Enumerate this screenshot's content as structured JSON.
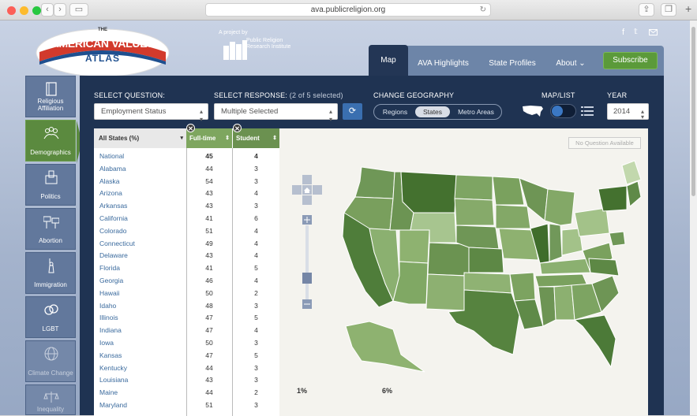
{
  "browser": {
    "url": "ava.publicreligion.org"
  },
  "header": {
    "logo_top": "THE",
    "logo_main": "AMERICAN VALUES",
    "logo_sub": "ATLAS",
    "project_label": "A project by",
    "project_name": "Public Religion Research Institute"
  },
  "nav": {
    "tabs": [
      {
        "label": "Map",
        "active": true
      },
      {
        "label": "AVA Highlights"
      },
      {
        "label": "State Profiles"
      },
      {
        "label": "About ⌄"
      }
    ],
    "subscribe": "Subscribe"
  },
  "sidebar": {
    "items": [
      {
        "label": "Religious Affiliation",
        "icon": "book-icon"
      },
      {
        "label": "Demographics",
        "icon": "people-icon",
        "active": true
      },
      {
        "label": "Politics",
        "icon": "ballot-box-icon"
      },
      {
        "label": "Abortion",
        "icon": "signs-icon"
      },
      {
        "label": "Immigration",
        "icon": "statue-of-liberty-icon"
      },
      {
        "label": "LGBT",
        "icon": "rings-icon"
      },
      {
        "label": "Climate Change",
        "icon": "globe-icon"
      },
      {
        "label": "Inequality",
        "icon": "scales-icon"
      }
    ]
  },
  "controls": {
    "question_label": "SELECT QUESTION:",
    "question_value": "Employment Status",
    "response_label": "SELECT RESPONSE:",
    "response_count": "(2 of 5 selected)",
    "response_value": "Multiple Selected",
    "geo_label": "CHANGE GEOGRAPHY",
    "geo_options": [
      "Regions",
      "States",
      "Metro Areas"
    ],
    "geo_selected": "States",
    "maplist_label": "MAP/LIST",
    "year_label": "YEAR",
    "year_value": "2014"
  },
  "table": {
    "header_state": "All States (%)",
    "header_col1": "Full-time",
    "header_col2": "Student",
    "rows": [
      {
        "state": "National",
        "fulltime": "45",
        "student": "4"
      },
      {
        "state": "Alabama",
        "fulltime": "44",
        "student": "3"
      },
      {
        "state": "Alaska",
        "fulltime": "54",
        "student": "3"
      },
      {
        "state": "Arizona",
        "fulltime": "43",
        "student": "4"
      },
      {
        "state": "Arkansas",
        "fulltime": "43",
        "student": "3"
      },
      {
        "state": "California",
        "fulltime": "41",
        "student": "6"
      },
      {
        "state": "Colorado",
        "fulltime": "51",
        "student": "4"
      },
      {
        "state": "Connecticut",
        "fulltime": "49",
        "student": "4"
      },
      {
        "state": "Delaware",
        "fulltime": "43",
        "student": "4"
      },
      {
        "state": "Florida",
        "fulltime": "41",
        "student": "5"
      },
      {
        "state": "Georgia",
        "fulltime": "46",
        "student": "4"
      },
      {
        "state": "Hawaii",
        "fulltime": "50",
        "student": "2"
      },
      {
        "state": "Idaho",
        "fulltime": "48",
        "student": "3"
      },
      {
        "state": "Illinois",
        "fulltime": "47",
        "student": "5"
      },
      {
        "state": "Indiana",
        "fulltime": "47",
        "student": "4"
      },
      {
        "state": "Iowa",
        "fulltime": "50",
        "student": "3"
      },
      {
        "state": "Kansas",
        "fulltime": "47",
        "student": "5"
      },
      {
        "state": "Kentucky",
        "fulltime": "44",
        "student": "3"
      },
      {
        "state": "Louisiana",
        "fulltime": "43",
        "student": "3"
      },
      {
        "state": "Maine",
        "fulltime": "44",
        "student": "2"
      },
      {
        "state": "Maryland",
        "fulltime": "51",
        "student": "3"
      }
    ]
  },
  "map": {
    "no_question": "No Question Available",
    "legend_min": "1%",
    "legend_mid": "6%"
  },
  "colors": {
    "accent_green": "#5b8a3f",
    "navy": "#1f3352",
    "link": "#3a6a9d"
  }
}
